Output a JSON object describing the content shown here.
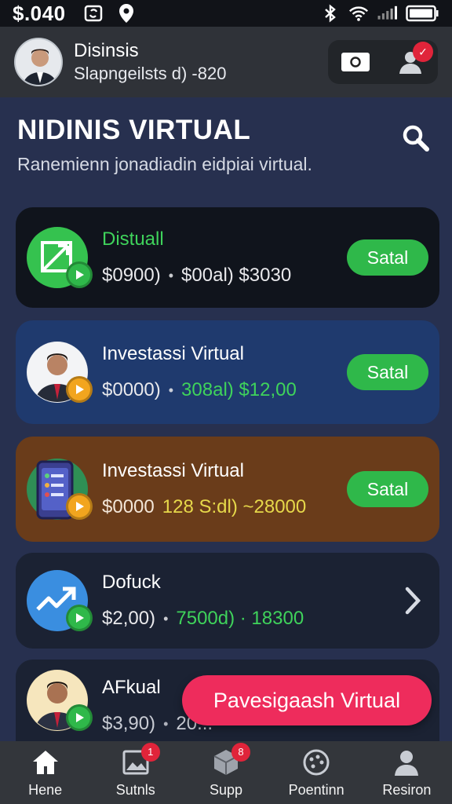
{
  "status_bar": {
    "time": "$.040",
    "icons": [
      "sync-icon",
      "location-icon",
      "bluetooth-icon",
      "wifi-icon",
      "signal-icon",
      "battery-icon"
    ]
  },
  "profile": {
    "name": "Disinsis",
    "subtitle": "Slapngeilsts d) -820",
    "actions": [
      "camera-icon",
      "user-icon"
    ],
    "notification_badge": "✓"
  },
  "page": {
    "title": "NIDINIS VIRTUAL",
    "subtitle": "Ranemienn jonadiadin eidpiai virtual."
  },
  "cards": [
    {
      "title": "Distuall",
      "value1": "$0900)",
      "value2": "$00al) $3030",
      "action": "Satal",
      "title_color": "#3fd35b",
      "bg": "#10141c",
      "icon": "trade-icon"
    },
    {
      "title": "Investassi Virtual",
      "value1": "$0000)",
      "value2": "308al) $12,00",
      "action": "Satal",
      "title_color": "#ffffff",
      "bg": "#1f3a6e",
      "icon": "avatar-icon"
    },
    {
      "title": "Investassi Virtual",
      "value1": "$0000",
      "value2": "128 S:dl) ~28000",
      "action": "Satal",
      "title_color": "#ffffff",
      "bg": "#6a3c1a",
      "icon": "phone-icon"
    },
    {
      "title": "Dofuck",
      "value1": "$2,00)",
      "value2": "7500d) · 18300",
      "action": "",
      "title_color": "#ffffff",
      "bg": "#1b2233",
      "icon": "chart-icon"
    },
    {
      "title": "AFkual",
      "value1": "$3,90)",
      "value2": "20...",
      "action": "",
      "title_color": "#ffffff",
      "bg": "#1b2233",
      "icon": "avatar-icon"
    }
  ],
  "fab_label": "Pavesigaash Virtual",
  "nav": [
    {
      "label": "Hene",
      "badge": ""
    },
    {
      "label": "Sutnls",
      "badge": "1"
    },
    {
      "label": "Supp",
      "badge": "8"
    },
    {
      "label": "Poentinn",
      "badge": ""
    },
    {
      "label": "Resiron",
      "badge": ""
    }
  ],
  "colors": {
    "accent_green": "#2fb84a",
    "fab": "#ee2c5c",
    "badge_red": "#e0243a",
    "value_green": "#3fd35b",
    "value_yellow": "#e6d84a"
  }
}
